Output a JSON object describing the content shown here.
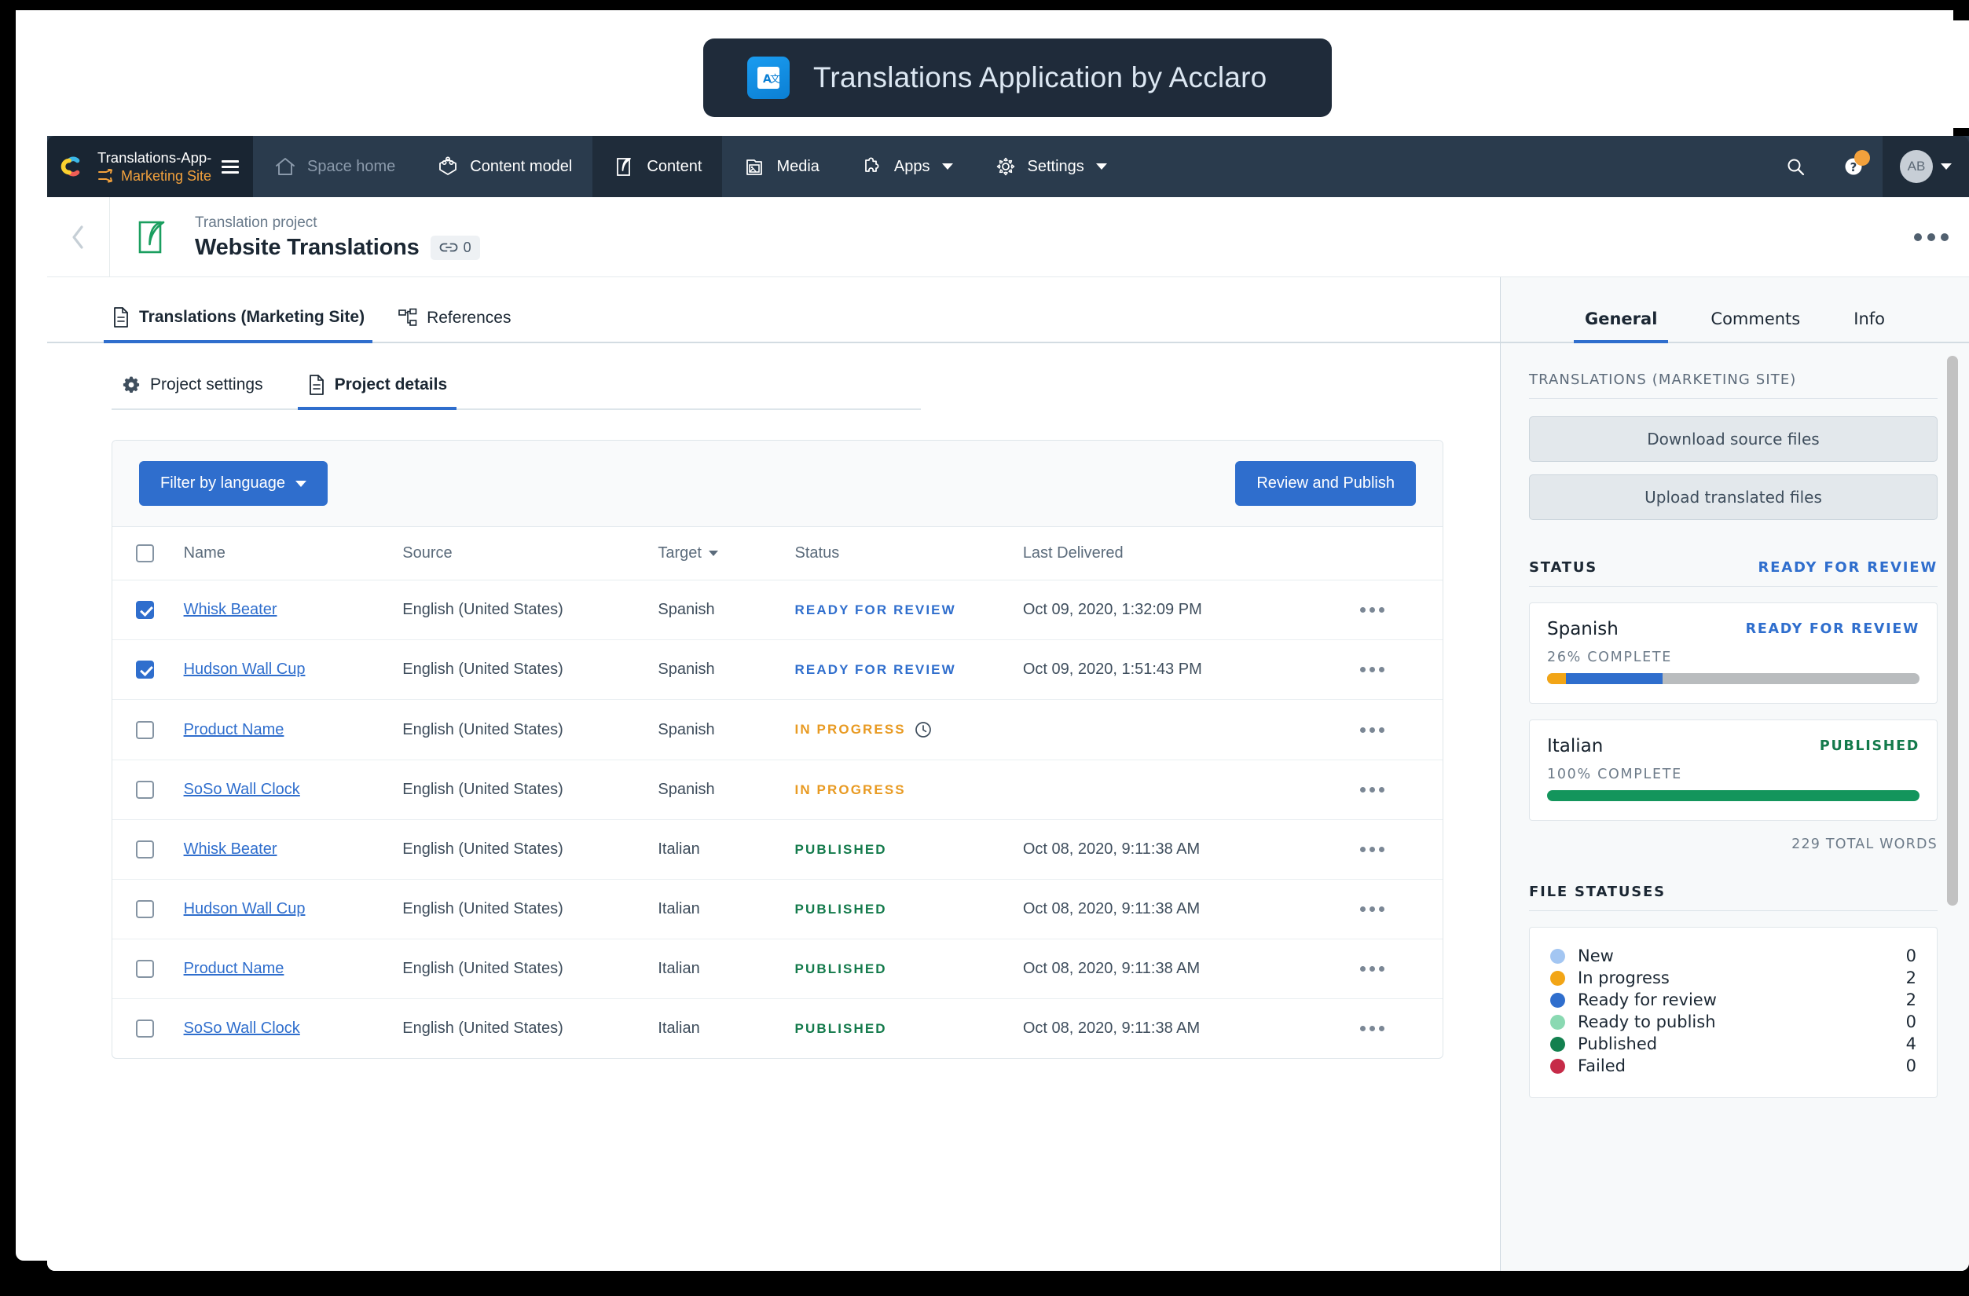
{
  "banner": {
    "title": "Translations Application by Acclaro",
    "icon": "translate-icon"
  },
  "navbar": {
    "space_name": "Translations-App-Devel...",
    "environment": "Marketing Site",
    "items": [
      {
        "label": "Space home",
        "icon": "home-icon",
        "active": false,
        "dim": true
      },
      {
        "label": "Content model",
        "icon": "content-model-icon",
        "active": false,
        "dim": false
      },
      {
        "label": "Content",
        "icon": "content-icon",
        "active": true,
        "dim": false
      },
      {
        "label": "Media",
        "icon": "media-icon",
        "active": false,
        "dim": false
      },
      {
        "label": "Apps",
        "icon": "apps-icon",
        "active": false,
        "dim": false,
        "caret": true
      },
      {
        "label": "Settings",
        "icon": "gear-icon",
        "active": false,
        "dim": false,
        "caret": true
      }
    ],
    "search_icon": "search-icon",
    "help_icon": "help-icon",
    "avatar_initials": "AB"
  },
  "entry_header": {
    "kicker": "Translation project",
    "title": "Website Translations",
    "link_count": "0",
    "back_icon": "chevron-left-icon",
    "entry_icon": "translation-project-icon",
    "overflow_icon": "more-horizontal-icon"
  },
  "primary_tabs": [
    {
      "label": "Translations (Marketing Site)",
      "icon": "document-icon",
      "active": true
    },
    {
      "label": "References",
      "icon": "references-icon",
      "active": false
    }
  ],
  "secondary_tabs": [
    {
      "label": "Project settings",
      "icon": "gear-icon",
      "active": false
    },
    {
      "label": "Project details",
      "icon": "document-icon",
      "active": true
    }
  ],
  "toolbar": {
    "filter_label": "Filter by language",
    "review_publish_label": "Review and Publish"
  },
  "table": {
    "columns": [
      "Name",
      "Source",
      "Target",
      "Status",
      "Last Delivered"
    ],
    "sorted_column": "Target",
    "rows": [
      {
        "checked": true,
        "name": "Whisk Beater",
        "source": "English (United States)",
        "target": "Spanish",
        "status": "READY FOR REVIEW",
        "status_kind": "ready",
        "clock": false,
        "delivered": "Oct 09, 2020, 1:32:09 PM"
      },
      {
        "checked": true,
        "name": "Hudson Wall Cup",
        "source": "English (United States)",
        "target": "Spanish",
        "status": "READY FOR REVIEW",
        "status_kind": "ready",
        "clock": false,
        "delivered": "Oct 09, 2020, 1:51:43 PM"
      },
      {
        "checked": false,
        "name": "Product Name",
        "source": "English (United States)",
        "target": "Spanish",
        "status": "IN PROGRESS",
        "status_kind": "prog",
        "clock": true,
        "delivered": ""
      },
      {
        "checked": false,
        "name": "SoSo Wall Clock",
        "source": "English (United States)",
        "target": "Spanish",
        "status": "IN PROGRESS",
        "status_kind": "prog",
        "clock": false,
        "delivered": ""
      },
      {
        "checked": false,
        "name": "Whisk Beater",
        "source": "English (United States)",
        "target": "Italian",
        "status": "PUBLISHED",
        "status_kind": "pub",
        "clock": false,
        "delivered": "Oct 08, 2020, 9:11:38 AM"
      },
      {
        "checked": false,
        "name": "Hudson Wall Cup",
        "source": "English (United States)",
        "target": "Italian",
        "status": "PUBLISHED",
        "status_kind": "pub",
        "clock": false,
        "delivered": "Oct 08, 2020, 9:11:38 AM"
      },
      {
        "checked": false,
        "name": "Product Name",
        "source": "English (United States)",
        "target": "Italian",
        "status": "PUBLISHED",
        "status_kind": "pub",
        "clock": false,
        "delivered": "Oct 08, 2020, 9:11:38 AM"
      },
      {
        "checked": false,
        "name": "SoSo Wall Clock",
        "source": "English (United States)",
        "target": "Italian",
        "status": "PUBLISHED",
        "status_kind": "pub",
        "clock": false,
        "delivered": "Oct 08, 2020, 9:11:38 AM"
      }
    ]
  },
  "sidebar": {
    "tabs": [
      {
        "label": "General",
        "active": true
      },
      {
        "label": "Comments",
        "active": false
      },
      {
        "label": "Info",
        "active": false
      }
    ],
    "app_section_title": "TRANSLATIONS (MARKETING SITE)",
    "download_label": "Download source files",
    "upload_label": "Upload translated files",
    "status_section": {
      "title": "STATUS",
      "value": "READY FOR REVIEW"
    },
    "languages": [
      {
        "name": "Spanish",
        "status": "READY FOR REVIEW",
        "status_kind": "ready",
        "percent_label": "26% COMPLETE",
        "segments": [
          {
            "color": "#f2a516",
            "width": 5
          },
          {
            "color": "#2f6ecd",
            "width": 26
          }
        ]
      },
      {
        "name": "Italian",
        "status": "PUBLISHED",
        "status_kind": "pub",
        "percent_label": "100% COMPLETE",
        "segments": [
          {
            "color": "#13955c",
            "width": 100
          }
        ]
      }
    ],
    "total_words": "229 TOTAL WORDS",
    "file_statuses_title": "FILE STATUSES",
    "file_statuses": [
      {
        "label": "New",
        "count": "0",
        "color": "#a3c6f2"
      },
      {
        "label": "In progress",
        "count": "2",
        "color": "#f2a516"
      },
      {
        "label": "Ready for review",
        "count": "2",
        "color": "#2f6ecd"
      },
      {
        "label": "Ready to publish",
        "count": "0",
        "color": "#8ad9b2"
      },
      {
        "label": "Published",
        "count": "4",
        "color": "#13804f"
      },
      {
        "label": "Failed",
        "count": "0",
        "color": "#c62b48"
      }
    ]
  }
}
